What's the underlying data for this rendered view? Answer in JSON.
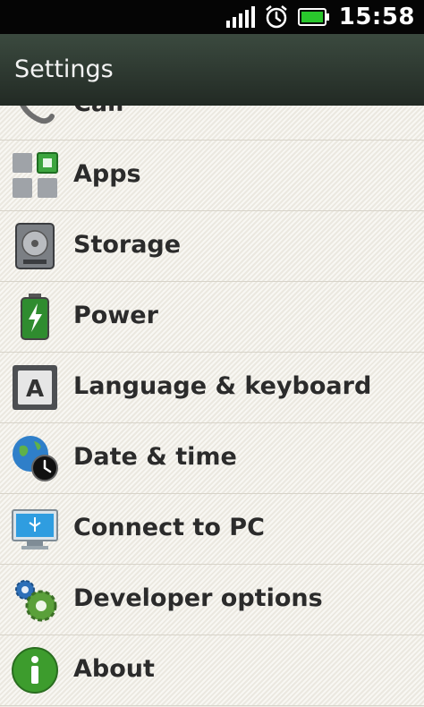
{
  "status_bar": {
    "time": "15:58",
    "signal_icon": "signal-bars-icon",
    "alarm_icon": "alarm-clock-icon",
    "battery_icon": "battery-icon",
    "battery_color": "#29c62c"
  },
  "app_bar": {
    "title": "Settings",
    "background": "#2b352e"
  },
  "settings": {
    "items": [
      {
        "label": "Call",
        "icon": "phone-icon"
      },
      {
        "label": "Apps",
        "icon": "apps-grid-icon"
      },
      {
        "label": "Storage",
        "icon": "storage-drive-icon"
      },
      {
        "label": "Power",
        "icon": "battery-power-icon"
      },
      {
        "label": "Language & keyboard",
        "icon": "keyboard-letter-icon"
      },
      {
        "label": "Date & time",
        "icon": "globe-clock-icon"
      },
      {
        "label": "Connect to PC",
        "icon": "usb-monitor-icon"
      },
      {
        "label": "Developer options",
        "icon": "gears-icon"
      },
      {
        "label": "About",
        "icon": "info-icon"
      }
    ]
  }
}
